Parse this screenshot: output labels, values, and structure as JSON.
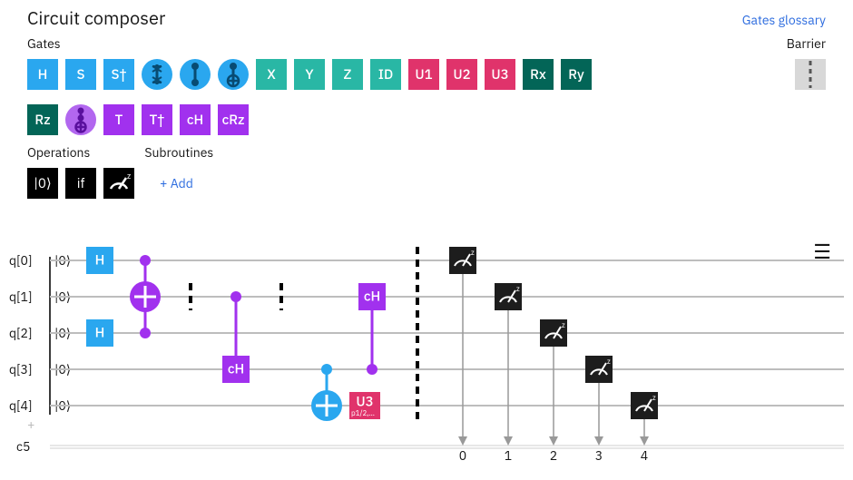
{
  "title": "Circuit composer",
  "glossary_link": "Gates glossary",
  "sections": {
    "gates": "Gates",
    "barrier": "Barrier",
    "operations": "Operations",
    "subroutines": "Subroutines",
    "add_subroutine": "+ Add"
  },
  "palette": {
    "H": {
      "label": "H",
      "color": "#2aa7ef",
      "shape": "square"
    },
    "S": {
      "label": "S",
      "color": "#2aa7ef",
      "shape": "square"
    },
    "Sd": {
      "label": "S†",
      "color": "#2aa7ef",
      "shape": "square"
    },
    "SW": {
      "label": "swap",
      "color": "#2aa7ef",
      "shape": "round_swap"
    },
    "CP": {
      "label": "cp",
      "color": "#2aa7ef",
      "shape": "round_cp"
    },
    "CN": {
      "label": "cnot",
      "color": "#2aa7ef",
      "shape": "round_cnot"
    },
    "X": {
      "label": "X",
      "color": "#29b7a5",
      "shape": "square"
    },
    "Y": {
      "label": "Y",
      "color": "#29b7a5",
      "shape": "square"
    },
    "Z": {
      "label": "Z",
      "color": "#29b7a5",
      "shape": "square"
    },
    "ID": {
      "label": "ID",
      "color": "#29b7a5",
      "shape": "square"
    },
    "U1": {
      "label": "U1",
      "color": "#e0336b",
      "shape": "square"
    },
    "U2": {
      "label": "U2",
      "color": "#e0336b",
      "shape": "square"
    },
    "U3": {
      "label": "U3",
      "color": "#e0336b",
      "shape": "square"
    },
    "Rx": {
      "label": "Rx",
      "color": "#036557",
      "shape": "square"
    },
    "Ry": {
      "label": "Ry",
      "color": "#036557",
      "shape": "square"
    },
    "Rz": {
      "label": "Rz",
      "color": "#036557",
      "shape": "square"
    },
    "CCX": {
      "label": "ccx",
      "color": "#b267ef",
      "shape": "round_ccx"
    },
    "T": {
      "label": "T",
      "color": "#a131ee",
      "shape": "square"
    },
    "Td": {
      "label": "T†",
      "color": "#a131ee",
      "shape": "square"
    },
    "cH": {
      "label": "cH",
      "color": "#a131ee",
      "shape": "square"
    },
    "cRz": {
      "label": "cRz",
      "color": "#a131ee",
      "shape": "square"
    }
  },
  "operations": {
    "reset": "|0⟩",
    "if": "if",
    "measure": "measure"
  },
  "circuit": {
    "qubits": [
      "q[0]",
      "q[1]",
      "q[2]",
      "q[3]",
      "q[4]"
    ],
    "ket": "|0⟩",
    "classical_label": "c5",
    "bit_labels": [
      "0",
      "1",
      "2",
      "3",
      "4"
    ],
    "u3_label": "U3",
    "u3_params": "p1/2,…",
    "gate_cH": "cH",
    "gate_H": "H",
    "columns": [
      {
        "type": "H",
        "targets": [
          0,
          2
        ]
      },
      {
        "type": "toffoli_purple",
        "controls": [
          0,
          2
        ],
        "target_plus": 1
      },
      {
        "type": "barrier",
        "span": [
          1,
          1
        ]
      },
      {
        "type": "cH",
        "control": 1,
        "target": 3
      },
      {
        "type": "barrier",
        "span": [
          1,
          1
        ]
      },
      {
        "type": "cnot_blue",
        "control": 3,
        "target_plus": 4
      },
      {
        "type": "u3",
        "target": 4
      },
      {
        "type": "cH",
        "control": 3,
        "target": 1
      },
      {
        "type": "barrier",
        "span": [
          0,
          4
        ]
      },
      {
        "type": "measure",
        "qubit": 0,
        "bit": 0
      },
      {
        "type": "measure",
        "qubit": 1,
        "bit": 1
      },
      {
        "type": "measure",
        "qubit": 2,
        "bit": 2
      },
      {
        "type": "measure",
        "qubit": 3,
        "bit": 3
      },
      {
        "type": "measure",
        "qubit": 4,
        "bit": 4
      }
    ]
  }
}
